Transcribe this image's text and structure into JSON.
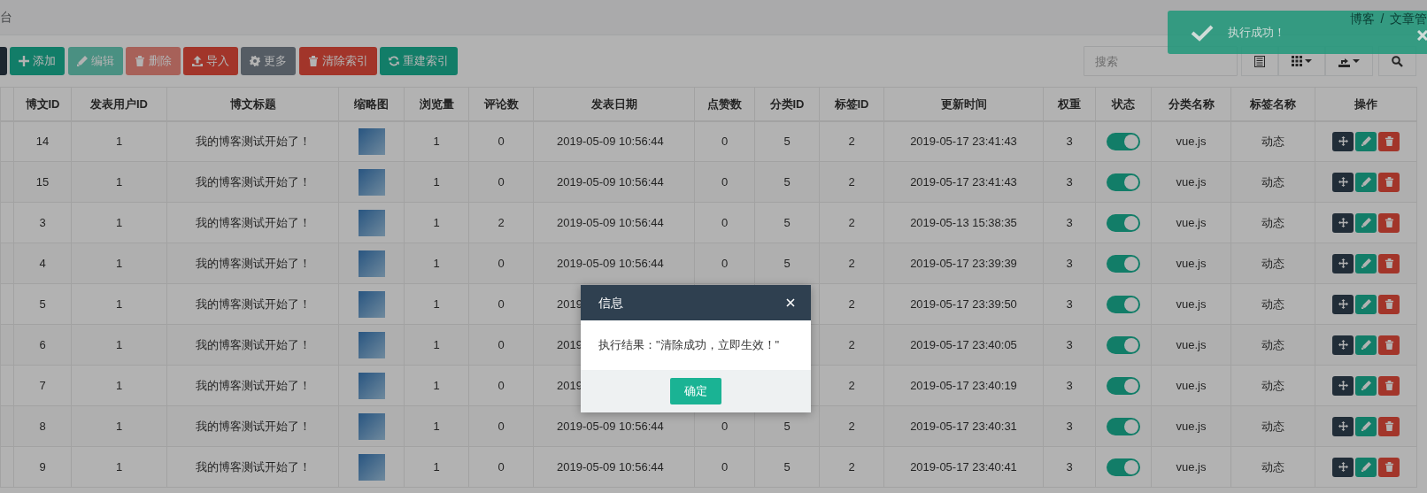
{
  "header": {
    "title": "台",
    "breadcrumb": [
      "博客",
      "/",
      "文章管"
    ]
  },
  "toolbar": {
    "buttons": [
      {
        "kind": "partial",
        "disabled": false
      },
      {
        "kind": "add",
        "label": "添加",
        "disabled": false
      },
      {
        "kind": "edit",
        "label": "编辑",
        "disabled": true
      },
      {
        "kind": "delete",
        "label": "删除",
        "disabled": true
      },
      {
        "kind": "import",
        "label": "导入",
        "disabled": false
      },
      {
        "kind": "more",
        "label": "更多",
        "disabled": false
      },
      {
        "kind": "clear",
        "label": "清除索引",
        "disabled": false
      },
      {
        "kind": "rebuild",
        "label": "重建索引",
        "disabled": false
      }
    ],
    "search": {
      "placeholder": "搜索"
    }
  },
  "table": {
    "columns": [
      "博文ID",
      "发表用户ID",
      "博文标题",
      "缩略图",
      "浏览量",
      "评论数",
      "发表日期",
      "点赞数",
      "分类ID",
      "标签ID",
      "更新时间",
      "权重",
      "状态",
      "分类名称",
      "标签名称",
      "操作"
    ],
    "rows": [
      {
        "id": "14",
        "user_id": "1",
        "title": "我的博客测试开始了！",
        "views": "1",
        "comments": "0",
        "published": "2019-05-09 10:56:44",
        "likes": "0",
        "category_id": "5",
        "tag_id": "2",
        "updated": "2019-05-17 23:41:43",
        "weight": "3",
        "enabled": true,
        "category": "vue.js",
        "tag": "动态"
      },
      {
        "id": "15",
        "user_id": "1",
        "title": "我的博客测试开始了！",
        "views": "1",
        "comments": "0",
        "published": "2019-05-09 10:56:44",
        "likes": "0",
        "category_id": "5",
        "tag_id": "2",
        "updated": "2019-05-17 23:41:43",
        "weight": "3",
        "enabled": true,
        "category": "vue.js",
        "tag": "动态"
      },
      {
        "id": "3",
        "user_id": "1",
        "title": "我的博客测试开始了！",
        "views": "1",
        "comments": "2",
        "published": "2019-05-09 10:56:44",
        "likes": "0",
        "category_id": "5",
        "tag_id": "2",
        "updated": "2019-05-13 15:38:35",
        "weight": "3",
        "enabled": true,
        "category": "vue.js",
        "tag": "动态"
      },
      {
        "id": "4",
        "user_id": "1",
        "title": "我的博客测试开始了！",
        "views": "1",
        "comments": "0",
        "published": "2019-05-09 10:56:44",
        "likes": "0",
        "category_id": "5",
        "tag_id": "2",
        "updated": "2019-05-17 23:39:39",
        "weight": "3",
        "enabled": true,
        "category": "vue.js",
        "tag": "动态"
      },
      {
        "id": "5",
        "user_id": "1",
        "title": "我的博客测试开始了！",
        "views": "1",
        "comments": "0",
        "published": "2019",
        "tag_id": "2",
        "updated": "2019-05-17 23:39:50",
        "weight": "3",
        "enabled": true,
        "category": "vue.js",
        "tag": "动态"
      },
      {
        "id": "6",
        "user_id": "1",
        "title": "我的博客测试开始了！",
        "views": "1",
        "comments": "0",
        "published": "2019",
        "tag_id": "2",
        "updated": "2019-05-17 23:40:05",
        "weight": "3",
        "enabled": true,
        "category": "vue.js",
        "tag": "动态"
      },
      {
        "id": "7",
        "user_id": "1",
        "title": "我的博客测试开始了！",
        "views": "1",
        "comments": "0",
        "published": "2019",
        "tag_id": "2",
        "updated": "2019-05-17 23:40:19",
        "weight": "3",
        "enabled": true,
        "category": "vue.js",
        "tag": "动态"
      },
      {
        "id": "8",
        "user_id": "1",
        "title": "我的博客测试开始了！",
        "views": "1",
        "comments": "0",
        "published": "2019-05-09 10:56:44",
        "likes": "0",
        "category_id": "5",
        "tag_id": "2",
        "updated": "2019-05-17 23:40:31",
        "weight": "3",
        "enabled": true,
        "category": "vue.js",
        "tag": "动态"
      },
      {
        "id": "9",
        "user_id": "1",
        "title": "我的博客测试开始了！",
        "views": "1",
        "comments": "0",
        "published": "2019-05-09 10:56:44",
        "likes": "0",
        "category_id": "5",
        "tag_id": "2",
        "updated": "2019-05-17 23:40:41",
        "weight": "3",
        "enabled": true,
        "category": "vue.js",
        "tag": "动态"
      }
    ]
  },
  "toast": {
    "message": "执行成功！"
  },
  "modal": {
    "title": "信息",
    "message": "执行结果：\"清除成功，立即生效！\"",
    "button": "确定"
  }
}
